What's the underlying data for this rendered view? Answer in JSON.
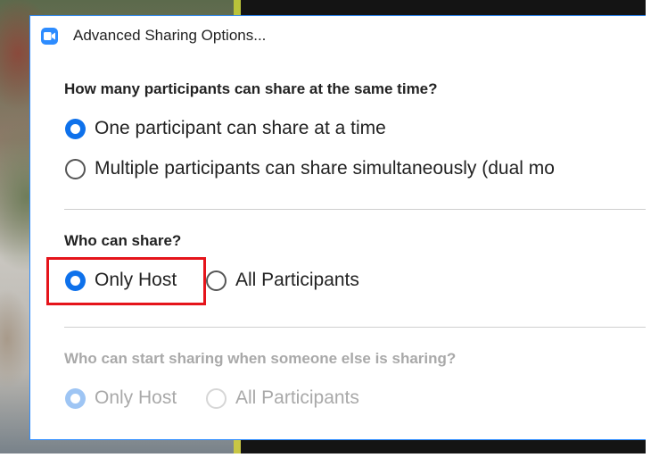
{
  "window": {
    "title": "Advanced Sharing Options...",
    "icon": "zoom-camera-icon"
  },
  "sections": {
    "simultaneous": {
      "heading": "How many participants can share at the same time?",
      "options": [
        {
          "label": "One participant can share at a time",
          "checked": true
        },
        {
          "label": "Multiple participants can share simultaneously (dual mo",
          "checked": false
        }
      ]
    },
    "who_can_share": {
      "heading": "Who can share?",
      "options": [
        {
          "label": "Only Host",
          "checked": true
        },
        {
          "label": "All Participants",
          "checked": false
        }
      ]
    },
    "start_while_sharing": {
      "heading": "Who can start sharing when someone else is sharing?",
      "enabled": false,
      "options": [
        {
          "label": "Only Host",
          "checked": true
        },
        {
          "label": "All Participants",
          "checked": false
        }
      ]
    }
  },
  "colors": {
    "accent": "#0e71eb",
    "highlight": "#e5141b",
    "dialog_border": "#2d8cff"
  }
}
